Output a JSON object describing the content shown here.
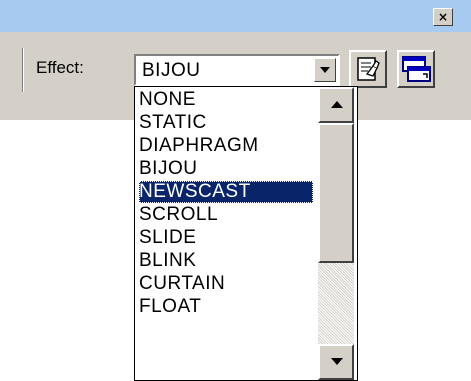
{
  "window": {
    "close_glyph": "×"
  },
  "toolbar": {
    "effect_label": "Effect:",
    "selected_value": "BIJOU",
    "properties_icon": "properties-icon",
    "window-swap_icon": "window-swap-icon"
  },
  "dropdown": {
    "items": [
      {
        "label": "NONE"
      },
      {
        "label": "STATIC"
      },
      {
        "label": "DIAPHRAGM"
      },
      {
        "label": "BIJOU"
      },
      {
        "label": "NEWSCAST"
      },
      {
        "label": "SCROLL"
      },
      {
        "label": "SLIDE"
      },
      {
        "label": "BLINK"
      },
      {
        "label": "CURTAIN"
      },
      {
        "label": "FLOAT"
      }
    ],
    "highlighted_index": 4
  },
  "colors": {
    "titlebar": "#a6caf0",
    "face": "#d4d0c8",
    "highlight": "#0a246a"
  }
}
